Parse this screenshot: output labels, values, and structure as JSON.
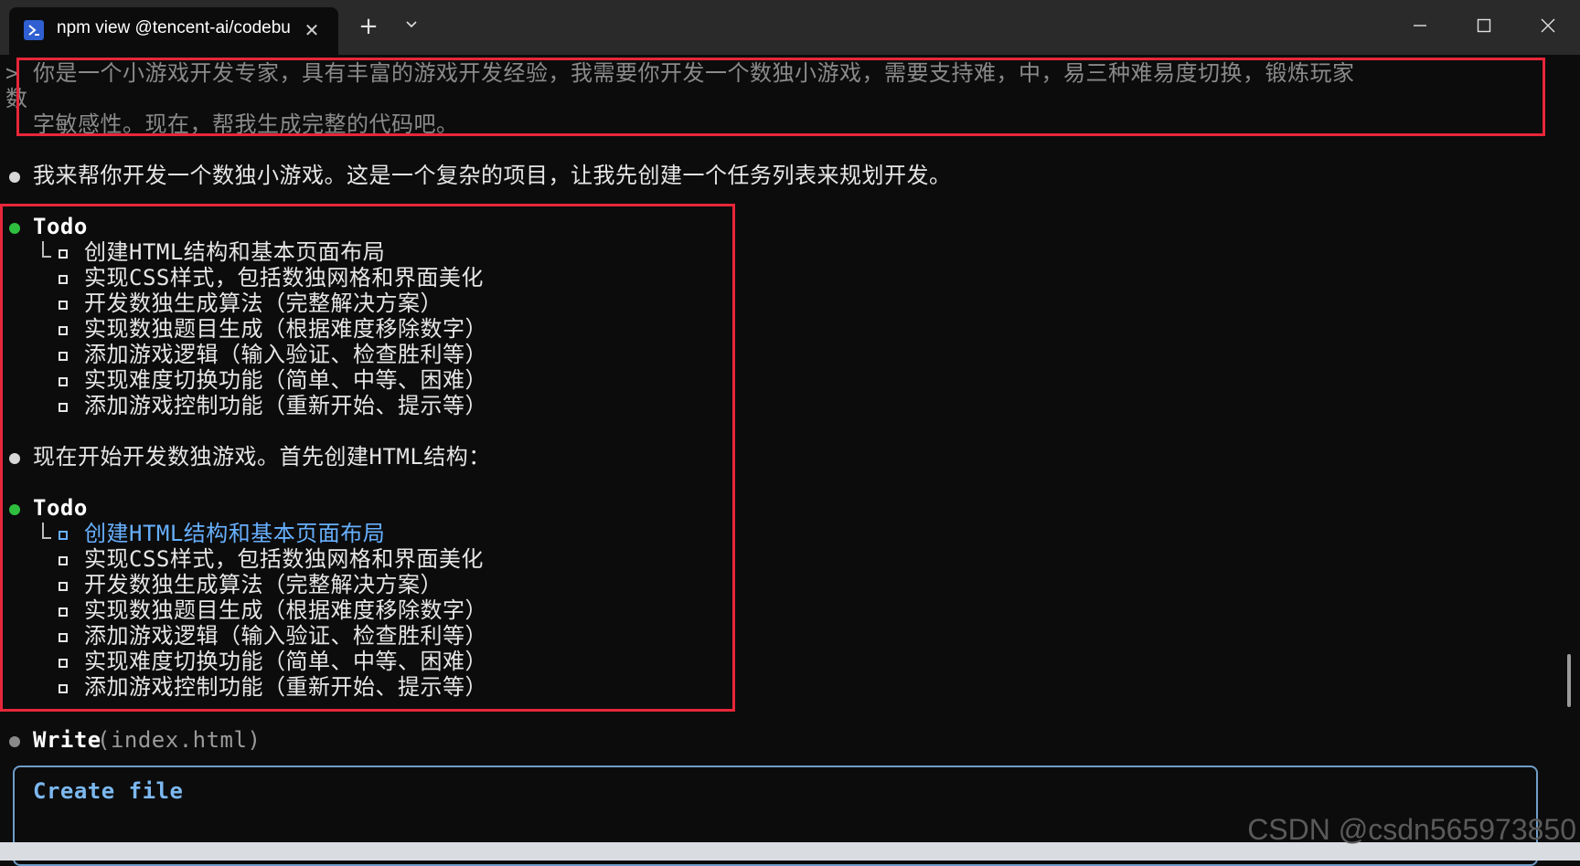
{
  "window": {
    "tab_title": "npm view @tencent-ai/codebu",
    "tab_icon": "powershell-icon",
    "new_tab_label": "+",
    "dropdown_icon": "chevron-down-icon",
    "close_tab_label": "✕"
  },
  "terminal": {
    "prompt_marker": ">",
    "prompt_line1": "你是一个小游戏开发专家，具有丰富的游戏开发经验，我需要你开发一个数独小游戏，需要支持难，中，易三种难易度切换，锻炼玩家",
    "prompt_line1_wrap": "数",
    "prompt_line2": "字敏感性。现在，帮我生成完整的代码吧。",
    "response1": "我来帮你开发一个数独小游戏。这是一个复杂的项目，让我先创建一个任务列表来规划开发。",
    "todo_title": "Todo",
    "todo_items": [
      "创建HTML结构和基本页面布局",
      "实现CSS样式，包括数独网格和界面美化",
      "开发数独生成算法（完整解决方案）",
      "实现数独题目生成（根据难度移除数字）",
      "添加游戏逻辑（输入验证、检查胜利等）",
      "实现难度切换功能（简单、中等、困难）",
      "添加游戏控制功能（重新开始、提示等）"
    ],
    "response2": "现在开始开发数独游戏。首先创建HTML结构：",
    "write_cmd": "Write",
    "write_arg": "(index.html)",
    "create_file_label": "Create file"
  },
  "watermark": "CSDN @csdn565973850",
  "colors": {
    "background": "#0c0c0c",
    "titlebar": "#2a2a2a",
    "highlight_border": "#e8263a",
    "active_item": "#67b0ff",
    "bullet_green": "#2fbf3f"
  }
}
